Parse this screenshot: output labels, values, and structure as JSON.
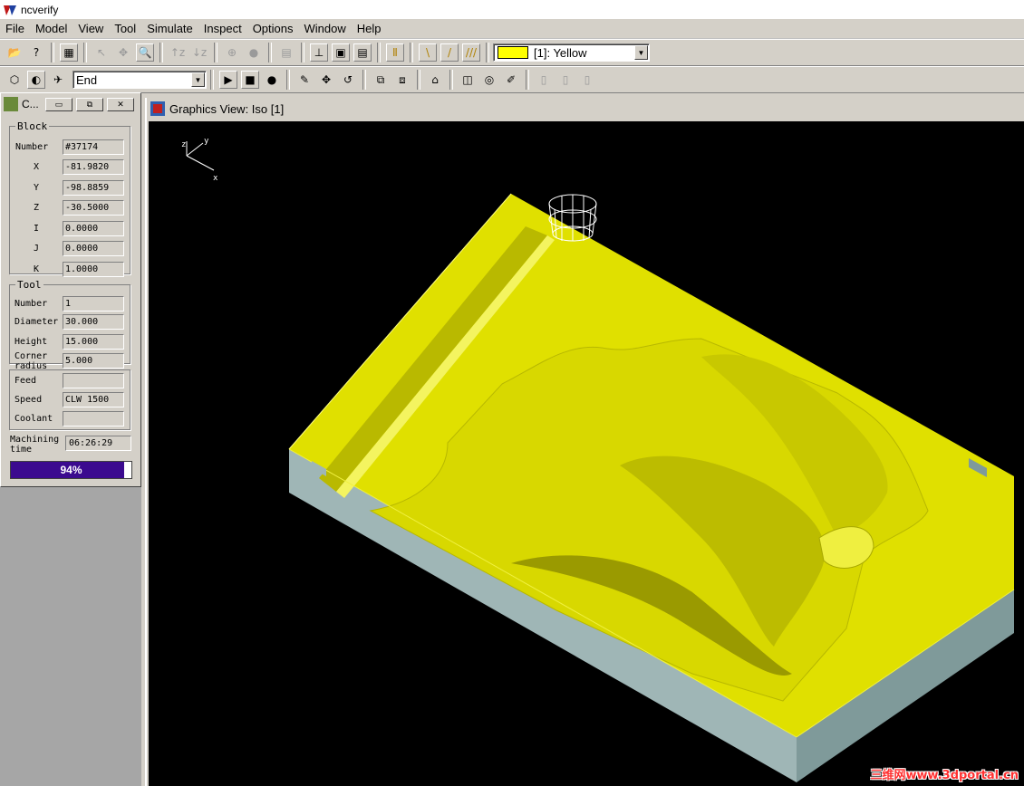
{
  "app": {
    "title": "ncverify"
  },
  "menu": [
    "File",
    "Model",
    "View",
    "Tool",
    "Simulate",
    "Inspect",
    "Options",
    "Window",
    "Help"
  ],
  "toolbar1": {
    "buttons": [
      "open-icon",
      "whats-this-icon",
      "report-icon",
      "select-arrow-icon",
      "pan-icon",
      "zoom-icon",
      "z-up-icon",
      "z-down-icon",
      "center-icon",
      "fill-icon",
      "stack-icon",
      "axis-icon",
      "snapshot-icon",
      "print-icon",
      "tool-icon",
      "cutter-icon",
      "holder-icon",
      "tools-icon"
    ],
    "color_select": {
      "value": "[1]: Yellow",
      "swatch": "#ffff00"
    }
  },
  "toolbar2": {
    "mode_select": {
      "value": "End"
    },
    "buttons": [
      "play",
      "stop",
      "record"
    ]
  },
  "control_panel": {
    "title": "C...",
    "block": {
      "legend": "Block",
      "rows": [
        {
          "label": "Number",
          "value": "#37174"
        },
        {
          "label": "X",
          "value": "-81.9820"
        },
        {
          "label": "Y",
          "value": "-98.8859"
        },
        {
          "label": "Z",
          "value": "-30.5000"
        },
        {
          "label": "I",
          "value": "0.0000"
        },
        {
          "label": "J",
          "value": "0.0000"
        },
        {
          "label": "K",
          "value": "1.0000"
        }
      ]
    },
    "tool": {
      "legend": "Tool",
      "rows": [
        {
          "label": "Number",
          "value": "1"
        },
        {
          "label": "Diameter",
          "value": "30.000"
        },
        {
          "label": "Height",
          "value": "15.000"
        },
        {
          "label": "Corner radius",
          "value": "5.000"
        }
      ]
    },
    "machine": {
      "rows": [
        {
          "label": "Feed",
          "value": ""
        },
        {
          "label": "Speed",
          "value": "CLW 1500"
        },
        {
          "label": "Coolant",
          "value": ""
        }
      ]
    },
    "machining_time": {
      "label": "Machining time",
      "value": "06:26:29"
    },
    "progress": {
      "value": 0.94,
      "text": "94%",
      "color": "#3b0a8f"
    }
  },
  "graphics": {
    "title": "Graphics View: Iso [1]",
    "axes": {
      "z": "z",
      "y": "y",
      "x": "x"
    },
    "model_color": "#e0e000",
    "side_color": "#9fb6b6"
  },
  "watermark": "三维网www.3dportal.cn"
}
